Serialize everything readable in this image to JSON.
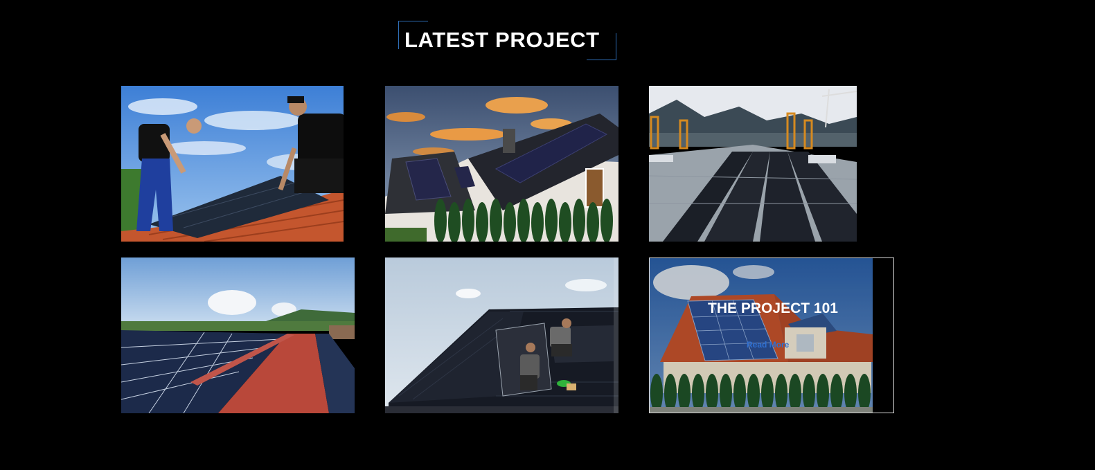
{
  "section": {
    "title": "LATEST PROJECT",
    "accent_color": "#2f6fb8"
  },
  "gallery": [
    {
      "id": "project-1",
      "alt": "Two workers installing solar panel on tiled roof"
    },
    {
      "id": "project-2",
      "alt": "House with black solar roof at sunset"
    },
    {
      "id": "project-3",
      "alt": "Flat industrial roof covered with solar panels and cranes"
    },
    {
      "id": "project-4",
      "alt": "Rows of solar panels on red metal roofs with hills"
    },
    {
      "id": "project-5",
      "alt": "Two workers mounting solar panels on dark roof"
    },
    {
      "id": "project-6",
      "alt": "House with solar panels on red roof",
      "overlay_title": "THE PROJECT 101",
      "overlay_link": "Read More",
      "link_color": "#2f6fd0"
    }
  ]
}
